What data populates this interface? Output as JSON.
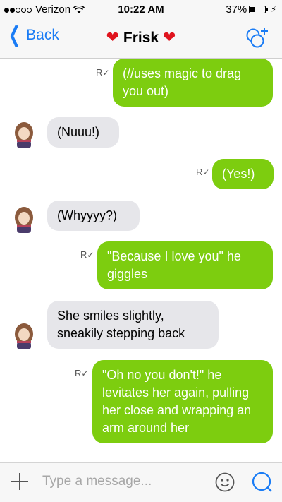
{
  "status_bar": {
    "carrier": "Verizon",
    "time": "10:22 AM",
    "battery": "37%",
    "battery_level": 0.37
  },
  "nav": {
    "back_label": "Back",
    "contact_name": "Frisk"
  },
  "messages": [
    {
      "dir": "out",
      "text": "(//uses magic to drag you out)",
      "read_receipt": "R"
    },
    {
      "dir": "in",
      "text": "(Nuuu!)"
    },
    {
      "dir": "out",
      "text": "(Yes!)",
      "read_receipt": "R"
    },
    {
      "dir": "in",
      "text": "(Whyyyy?)"
    },
    {
      "dir": "out",
      "text": "\"Because I love you\" he giggles",
      "read_receipt": "R"
    },
    {
      "dir": "in",
      "text": "She smiles slightly, sneakily stepping back"
    },
    {
      "dir": "out",
      "text": "\"Oh no you don't!\" he levitates her again, pulling her close and wrapping an arm around her",
      "read_receipt": "R"
    }
  ],
  "input": {
    "placeholder": "Type a message..."
  },
  "colors": {
    "accent": "#1a7cf5",
    "outgoing_bubble": "#7dcd0f",
    "incoming_bubble": "#e6e6ea",
    "heart": "#e0141e"
  },
  "icons": {
    "back": "chevron-left-icon",
    "add_participant": "add-participant-icon",
    "attach": "plus-icon",
    "emoji": "emoji-icon",
    "send": "send-icon",
    "heart": "heart-icon"
  }
}
